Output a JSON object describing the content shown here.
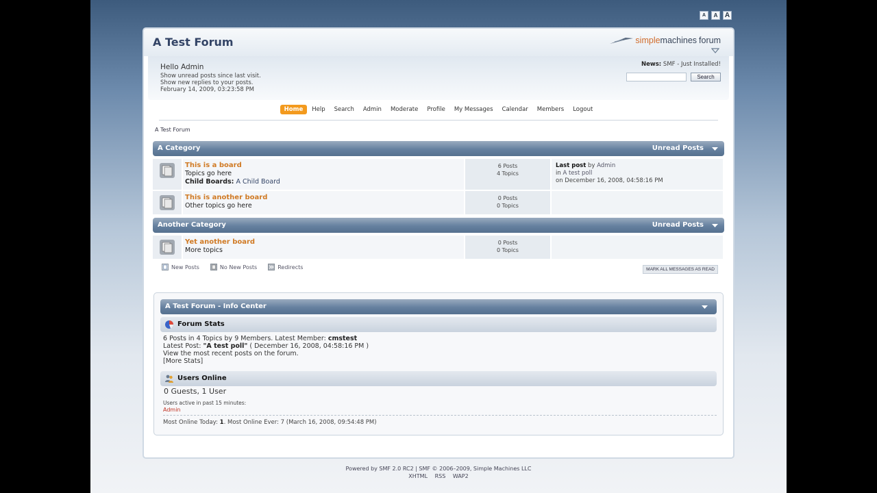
{
  "font_sizer": [
    "A",
    "A",
    "A"
  ],
  "header": {
    "title": "A Test Forum",
    "logo": {
      "part1": "simple",
      "part2": "machines",
      "part3": "forum"
    }
  },
  "userbox": {
    "greeting": "Hello Admin",
    "unread_link": "Show unread posts since last visit.",
    "replies_link": "Show new replies to your posts.",
    "datetime": "February 14, 2009, 03:23:58 PM",
    "news_label": "News:",
    "news_text": " SMF - Just Installed!",
    "search_button": "Search"
  },
  "menu": [
    "Home",
    "Help",
    "Search",
    "Admin",
    "Moderate",
    "Profile",
    "My Messages",
    "Calendar",
    "Members",
    "Logout"
  ],
  "breadcrumb": "A Test Forum",
  "categories": [
    {
      "title": "A Category",
      "unread": "Unread Posts",
      "boards": [
        {
          "name": "This is a board",
          "desc": "Topics go here",
          "child_label": "Child Boards:",
          "child_board": " A Child Board",
          "posts": "6 Posts",
          "topics": "4 Topics",
          "last_post_label": "Last post",
          "last_by": " by ",
          "last_author": "Admin",
          "last_in": "in ",
          "last_topic": "A test poll",
          "last_date": "on December 16, 2008, 04:58:16 PM"
        },
        {
          "name": "This is another board",
          "desc": "Other topics go here",
          "posts": "0 Posts",
          "topics": "0 Topics"
        }
      ]
    },
    {
      "title": "Another Category",
      "unread": "Unread Posts",
      "boards": [
        {
          "name": "Yet another board",
          "desc": "More topics",
          "posts": "0 Posts",
          "topics": "0 Topics"
        }
      ]
    }
  ],
  "legend": {
    "new_posts": "New Posts",
    "no_new_posts": "No New Posts",
    "redirects": "Redirects"
  },
  "mark_read": "MARK ALL MESSAGES AS READ",
  "info_center": {
    "title": "A Test Forum - Info Center",
    "stats_title": "Forum Stats",
    "stats_line1_prefix": "6 Posts in 4 Topics by 9 Members. Latest Member: ",
    "latest_member": "cmstest",
    "stats_line2_prefix": "Latest Post: ",
    "latest_post": "\"A test poll\"",
    "latest_post_date": " ( December 16, 2008, 04:58:16 PM )",
    "stats_line3": "View the most recent posts on the forum.",
    "more_stats": "[More Stats]",
    "online_title": "Users Online",
    "guests_users": "0 Guests, 1 User",
    "active_label": "Users active in past 15 minutes:",
    "active_user": "Admin",
    "most_online_prefix": "Most Online Today: ",
    "most_online_today": "1",
    "most_online_suffix": ". Most Online Ever: 7 (March 16, 2008, 09:54:48 PM)"
  },
  "footer": {
    "line1": "Powered by SMF 2.0 RC2 | SMF © 2006–2009, Simple Machines LLC",
    "links": [
      "XHTML",
      "RSS",
      "WAP2"
    ]
  },
  "colors": {
    "accent_orange": "#f39a1e",
    "board_link": "#d07a24",
    "cat_bar": "#65809f",
    "title": "#334466"
  }
}
